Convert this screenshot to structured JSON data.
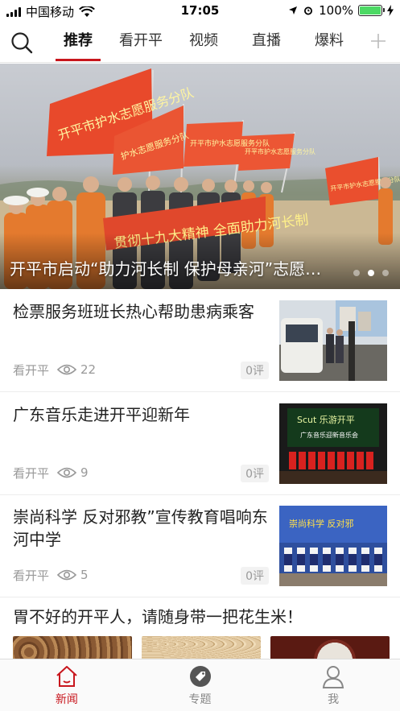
{
  "status_bar": {
    "carrier": "中国移动",
    "time": "17:05",
    "battery_percent": "100%",
    "battery_level": 1.0
  },
  "top_nav": {
    "tabs": [
      {
        "label": "推荐",
        "active": true
      },
      {
        "label": "看开平",
        "active": false
      },
      {
        "label": "视频",
        "active": false
      },
      {
        "label": "直播",
        "active": false
      },
      {
        "label": "爆料",
        "active": false
      }
    ],
    "accent_color": "#c8161d"
  },
  "banner": {
    "title": "开平市启动“助力河长制 保护母亲河”志愿服务活动",
    "slide_count": 3,
    "active_slide": 2,
    "flag_texts": [
      "开平市护水志愿服务分队",
      "护水志愿服务分队",
      "开平市护水志愿服务分队",
      "开平市护水志愿服务分队",
      "开平市护水志愿服务分队"
    ],
    "banner_text": "贯彻十九大精神 全面助力河长制"
  },
  "news": [
    {
      "title": "检票服务班班长热心帮助患病乘客",
      "source": "看开平",
      "views": "22",
      "comments": "0评"
    },
    {
      "title": "广东音乐走进开平迎新年",
      "source": "看开平",
      "views": "9",
      "comments": "0评"
    },
    {
      "title": "崇尚科学 反对邪教”宣传教育唱响东河中学",
      "source": "看开平",
      "views": "5",
      "comments": "0评"
    }
  ],
  "thumb_texts": {
    "music_line1": "Scut 乐游开平",
    "music_line2": "广东音乐迎新音乐会",
    "science": "崇尚科学 反对邪"
  },
  "last_news": {
    "title": "胃不好的开平人，请随身带一把花生米！"
  },
  "bottom_tabs": [
    {
      "label": "新闻",
      "icon": "home-icon",
      "active": true
    },
    {
      "label": "专题",
      "icon": "tag-icon",
      "active": false
    },
    {
      "label": "我",
      "icon": "user-icon",
      "active": false
    }
  ]
}
